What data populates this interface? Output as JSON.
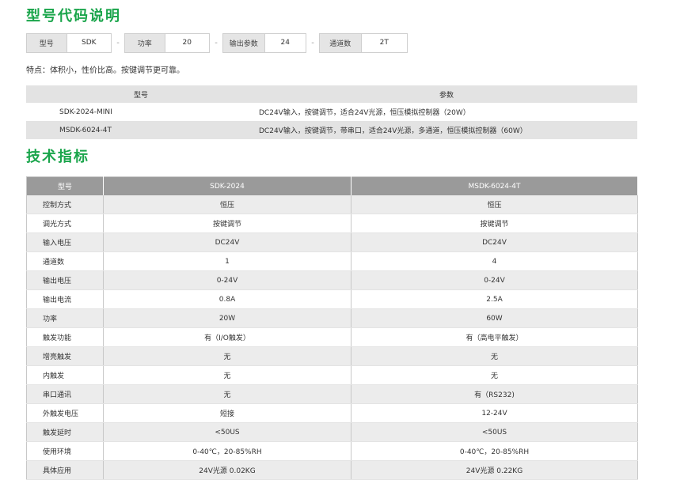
{
  "section1": {
    "title": "型号代码说明"
  },
  "code_fields": [
    {
      "label": "型号",
      "value": "SDK"
    },
    {
      "label": "功率",
      "value": "20"
    },
    {
      "label": "输出参数",
      "value": "24"
    },
    {
      "label": "通道数",
      "value": "2T"
    }
  ],
  "separator": "-",
  "feature_text": "特点：体积小，性价比高。按键调节更可靠。",
  "model_table": {
    "headers": [
      "型号",
      "参数"
    ],
    "rows": [
      [
        "SDK-2024-MINI",
        "DC24V输入，按键调节，适合24V光源，恒压模拟控制器（20W）"
      ],
      [
        "MSDK-6024-4T",
        "DC24V输入，按键调节，带串口，适合24V光源，多通道，恒压模拟控制器（60W）"
      ]
    ]
  },
  "section2": {
    "title": "技术指标"
  },
  "spec_table": {
    "headers": [
      "型号",
      "SDK-2024",
      "MSDK-6024-4T"
    ],
    "rows": [
      [
        "控制方式",
        "恒压",
        "恒压"
      ],
      [
        "调光方式",
        "按键调节",
        "按键调节"
      ],
      [
        "输入电压",
        "DC24V",
        "DC24V"
      ],
      [
        "通道数",
        "1",
        "4"
      ],
      [
        "输出电压",
        "0-24V",
        "0-24V"
      ],
      [
        "输出电流",
        "0.8A",
        "2.5A"
      ],
      [
        "功率",
        "20W",
        "60W"
      ],
      [
        "触发功能",
        "有（I/O触发）",
        "有（高电平触发）"
      ],
      [
        "增亮触发",
        "无",
        "无"
      ],
      [
        "内触发",
        "无",
        "无"
      ],
      [
        "串口通讯",
        "无",
        "有（RS232)"
      ],
      [
        "外触发电压",
        "短接",
        "12-24V"
      ],
      [
        "触发延时",
        "<50US",
        "<50US"
      ],
      [
        "使用环境",
        "0-40℃，20-85%RH",
        "0-40℃，20-85%RH"
      ],
      [
        "具体应用",
        "24V光源 0.02KG",
        "24V光源 0.22KG"
      ]
    ]
  }
}
